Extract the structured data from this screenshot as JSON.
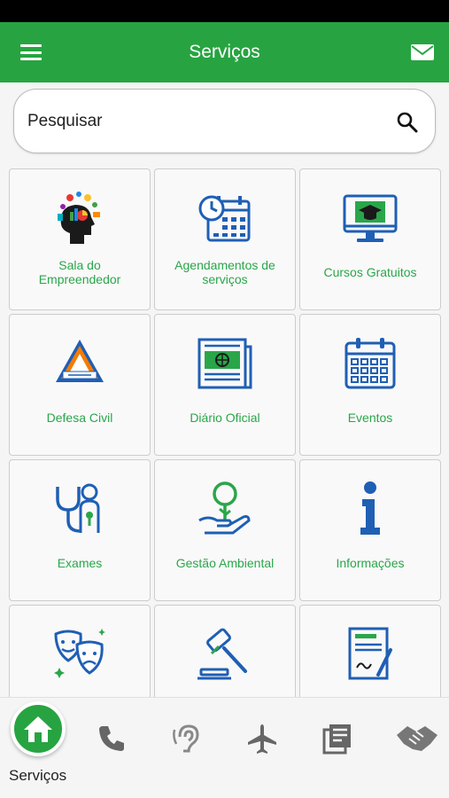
{
  "header": {
    "title": "Serviços"
  },
  "search": {
    "placeholder": "Pesquisar"
  },
  "tiles": [
    {
      "label": "Sala do\nEmpreendedor",
      "icon": "entrepreneur-head-icon"
    },
    {
      "label": "Agendamentos de serviços",
      "icon": "calendar-clock-icon"
    },
    {
      "label": "Cursos Gratuitos",
      "icon": "monitor-graduation-cap-icon"
    },
    {
      "label": "Defesa Civil",
      "icon": "civil-defense-badge-icon"
    },
    {
      "label": "Diário Oficial",
      "icon": "newspaper-icon"
    },
    {
      "label": "Eventos",
      "icon": "calendar-icon"
    },
    {
      "label": "Exames",
      "icon": "stethoscope-icon"
    },
    {
      "label": "Gestão Ambiental",
      "icon": "tree-in-hand-icon"
    },
    {
      "label": "Informações",
      "icon": "info-icon"
    },
    {
      "label": "",
      "icon": "theater-masks-icon"
    },
    {
      "label": "",
      "icon": "gavel-icon"
    },
    {
      "label": "",
      "icon": "contract-document-icon"
    }
  ],
  "bottom_nav": {
    "active_label": "Serviços",
    "items": [
      "home-icon",
      "phone-icon",
      "hearing-icon",
      "airplane-icon",
      "news-icon",
      "handshake-icon"
    ]
  },
  "colors": {
    "brand_green": "#27a441",
    "label_green": "#2aa64a",
    "icon_blue": "#1f5fb4"
  }
}
